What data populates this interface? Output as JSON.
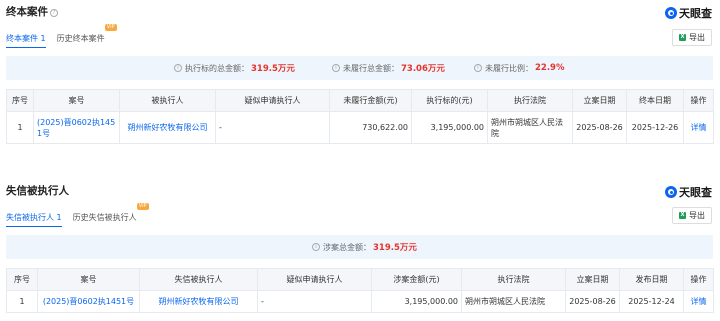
{
  "section1": {
    "title": "终本案件",
    "help": "?",
    "logo": "天眼查",
    "tabs": [
      {
        "label": "终本案件 1",
        "active": true
      },
      {
        "label": "历史终本案件",
        "vip": "VIP"
      }
    ],
    "export_label": "导出",
    "summary": [
      {
        "label": "执行标的总金额：",
        "value": "319.5万元"
      },
      {
        "label": "未履行总金额：",
        "value": "73.06万元"
      },
      {
        "label": "未履行比例：",
        "value": "22.9%"
      }
    ],
    "columns": [
      "序号",
      "案号",
      "被执行人",
      "疑似申请执行人",
      "未履行金额(元)",
      "执行标的(元)",
      "执行法院",
      "立案日期",
      "终本日期",
      "操作"
    ],
    "rows": [
      {
        "index": "1",
        "case_no": "(2025)晋0602执1451号",
        "defendant": "朔州新好农牧有限公司",
        "applicant": "-",
        "unpaid": "730,622.00",
        "target": "3,195,000.00",
        "court": "朔州市朔城区人民法院",
        "filed": "2025-08-26",
        "end": "2025-12-26",
        "action": "详情"
      }
    ]
  },
  "section2": {
    "title": "失信被执行人",
    "logo": "天眼查",
    "tabs": [
      {
        "label": "失信被执行人 1",
        "active": true
      },
      {
        "label": "历史失信被执行人",
        "vip": "VIP"
      }
    ],
    "export_label": "导出",
    "summary": [
      {
        "label": "涉案总金额：",
        "value": "319.5万元"
      }
    ],
    "columns": [
      "序号",
      "案号",
      "失信被执行人",
      "疑似申请执行人",
      "涉案金额(元)",
      "执行法院",
      "立案日期",
      "发布日期",
      "操作"
    ],
    "rows": [
      {
        "index": "1",
        "case_no": "(2025)晋0602执1451号",
        "defendant": "朔州新好农牧有限公司",
        "applicant": "-",
        "amount": "3,195,000.00",
        "court": "朔州市朔城区人民法院",
        "filed": "2025-08-26",
        "published": "2025-12-24",
        "action": "详情"
      }
    ]
  },
  "colors": {
    "accent": "#0a66f0",
    "highlight": "#e5342b",
    "summary_bg": "#eef5fd",
    "vip": "#f7a940"
  }
}
